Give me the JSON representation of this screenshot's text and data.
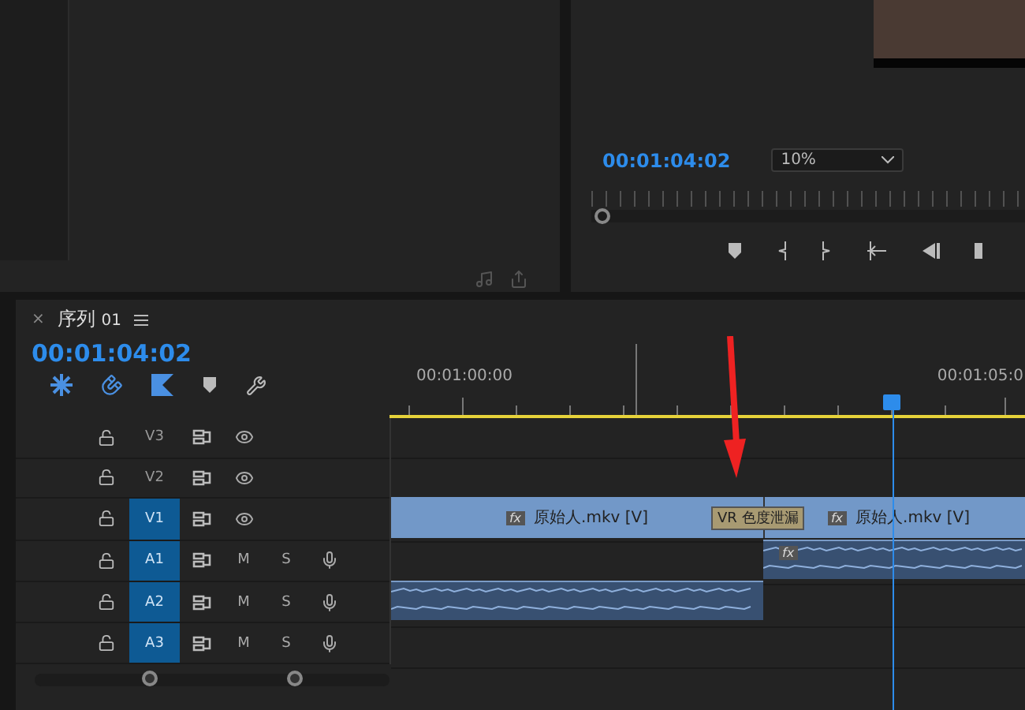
{
  "program_monitor": {
    "timecode": "00:01:04:02",
    "zoom": "10%"
  },
  "sequence": {
    "close": "×",
    "title": "序列",
    "number": "01",
    "timecode": "00:01:04:02",
    "ruler_labels": [
      "00:01:00:00",
      "00:01:05:0"
    ],
    "tracks": [
      {
        "label": "V3",
        "kind": "video",
        "targeted": false
      },
      {
        "label": "V2",
        "kind": "video",
        "targeted": false
      },
      {
        "label": "V1",
        "kind": "video",
        "targeted": true
      },
      {
        "label": "A1",
        "kind": "audio",
        "targeted": true,
        "mute": "M",
        "solo": "S"
      },
      {
        "label": "A2",
        "kind": "audio",
        "targeted": true,
        "mute": "M",
        "solo": "S"
      },
      {
        "label": "A3",
        "kind": "audio",
        "targeted": true,
        "mute": "M",
        "solo": "S"
      }
    ],
    "video_clips": [
      {
        "name": "原始人.mkv [V]",
        "fx": "fx"
      },
      {
        "name": "原始人.mkv [V]",
        "fx": "fx"
      }
    ],
    "audio_clip_fx": "fx",
    "transition": "VR 色度泄漏"
  }
}
